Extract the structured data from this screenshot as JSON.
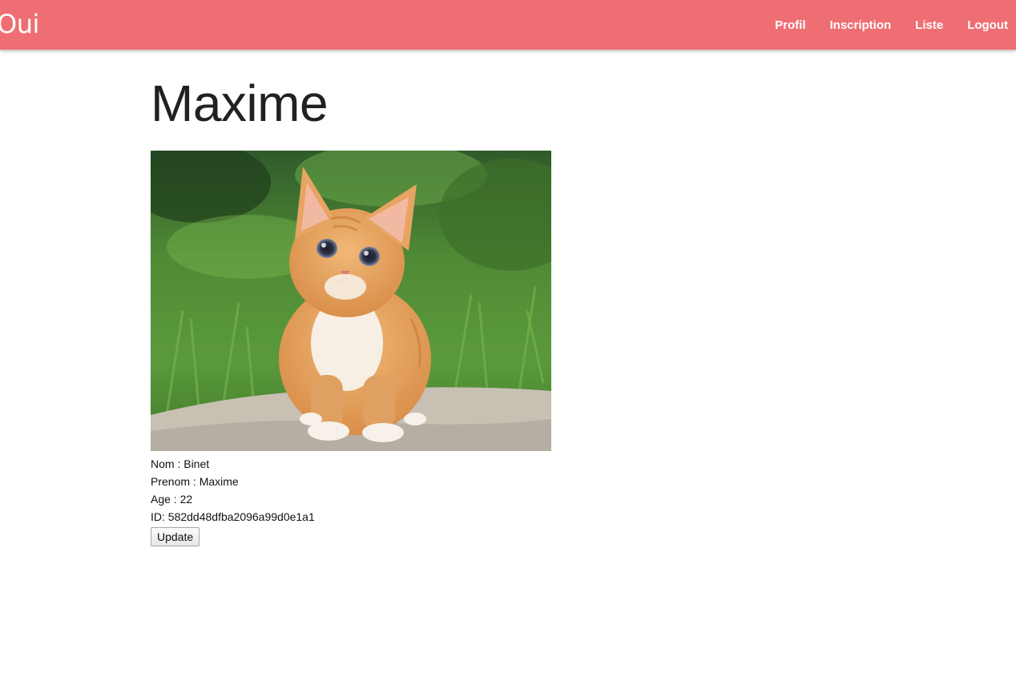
{
  "navbar": {
    "brand": "Oui",
    "links": [
      {
        "label": "Profil"
      },
      {
        "label": "Inscription"
      },
      {
        "label": "Liste"
      },
      {
        "label": "Logout"
      }
    ],
    "color": "#ef6e73"
  },
  "profile": {
    "title": "Maxime",
    "photo_icon": "kitten-photo",
    "fields": {
      "nom": "Nom : Binet",
      "prenom": "Prenom : Maxime",
      "age": "Age : 22",
      "id": "ID: 582dd48dfba2096a99d0e1a1"
    },
    "update_label": "Update"
  }
}
